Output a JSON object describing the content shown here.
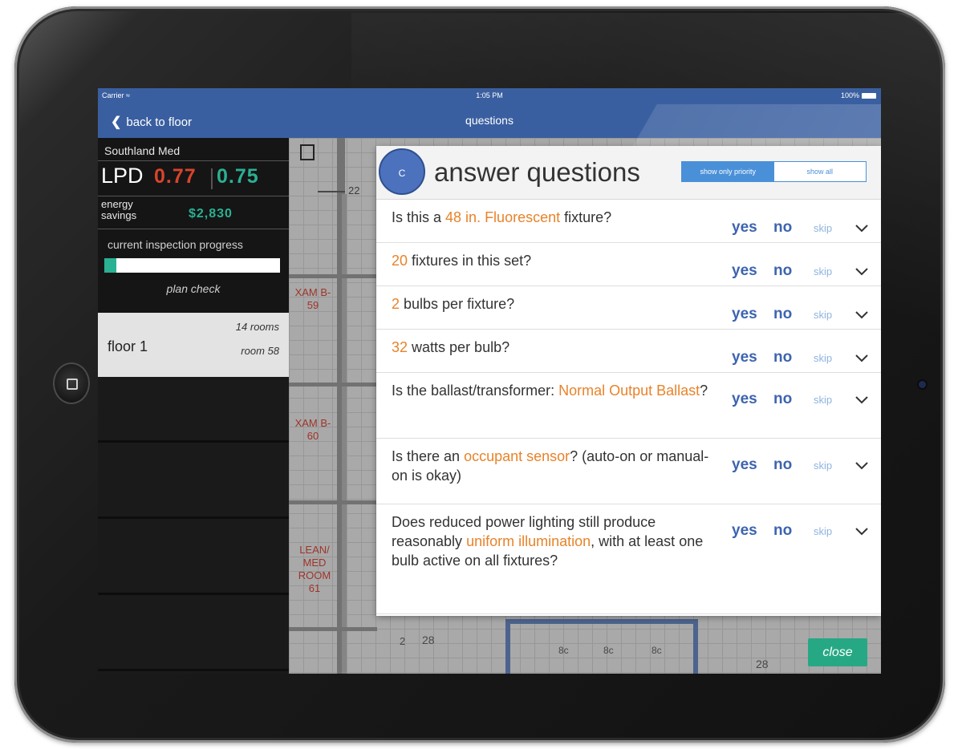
{
  "status_bar": {
    "carrier": "Carrier",
    "time": "1:05 PM",
    "battery": "100%"
  },
  "nav": {
    "back_label": "back to floor",
    "title": "questions"
  },
  "sidebar": {
    "facility": "Southland Med",
    "lpd_label": "LPD",
    "lpd_current": "0.77",
    "lpd_new": "0.75",
    "energy_label": "energy savings",
    "energy_value": "$2,830",
    "progress_label": "current inspection progress",
    "progress_fraction": 0.07,
    "plan_check": "plan check",
    "floor": {
      "name": "floor 1",
      "rooms": "14 rooms",
      "current_room": "room 58"
    }
  },
  "floorplan": {
    "rooms": [
      {
        "label": "XAM B-",
        "number": "59"
      },
      {
        "label": "XAM B-",
        "number": "60"
      },
      {
        "label": "LEAN/ MED ROOM",
        "number": "61"
      }
    ],
    "dimension": "22",
    "markers": [
      "2",
      "28",
      "28",
      "8c",
      "8c",
      "8c"
    ]
  },
  "panel": {
    "badge": "C",
    "title": "answer questions",
    "filter_priority": "show only priority",
    "filter_all": "show all",
    "answer_labels": {
      "yes": "yes",
      "no": "no",
      "skip": "skip"
    },
    "questions": [
      {
        "parts": [
          {
            "t": "Is this a ",
            "hl": false
          },
          {
            "t": "48 in. Fluorescent",
            "hl": true
          },
          {
            "t": " fixture?",
            "hl": false
          }
        ]
      },
      {
        "parts": [
          {
            "t": "20",
            "hl": true
          },
          {
            "t": " fixtures in this set?",
            "hl": false
          }
        ]
      },
      {
        "parts": [
          {
            "t": "2",
            "hl": true
          },
          {
            "t": " bulbs per fixture?",
            "hl": false
          }
        ]
      },
      {
        "parts": [
          {
            "t": "32",
            "hl": true
          },
          {
            "t": " watts per bulb?",
            "hl": false
          }
        ]
      },
      {
        "parts": [
          {
            "t": "Is the ballast/transformer: ",
            "hl": false
          },
          {
            "t": "Normal Output Ballast",
            "hl": true
          },
          {
            "t": "?",
            "hl": false
          }
        ]
      },
      {
        "parts": [
          {
            "t": "Is there an ",
            "hl": false
          },
          {
            "t": "occupant sensor",
            "hl": true
          },
          {
            "t": "? (auto-on or manual-on is okay)",
            "hl": false
          }
        ]
      },
      {
        "parts": [
          {
            "t": "Does reduced power lighting still produce reasonably ",
            "hl": false
          },
          {
            "t": "uniform illumination",
            "hl": true
          },
          {
            "t": ", with at least one bulb active on all fixtures?",
            "hl": false
          }
        ]
      }
    ],
    "close_label": "close"
  },
  "colors": {
    "nav_blue": "#3a5fa0",
    "highlight_orange": "#e8832a",
    "answer_blue": "#3d64b0",
    "lpd_red": "#d9442b",
    "savings_green": "#2ab093",
    "close_green": "#27a884"
  }
}
